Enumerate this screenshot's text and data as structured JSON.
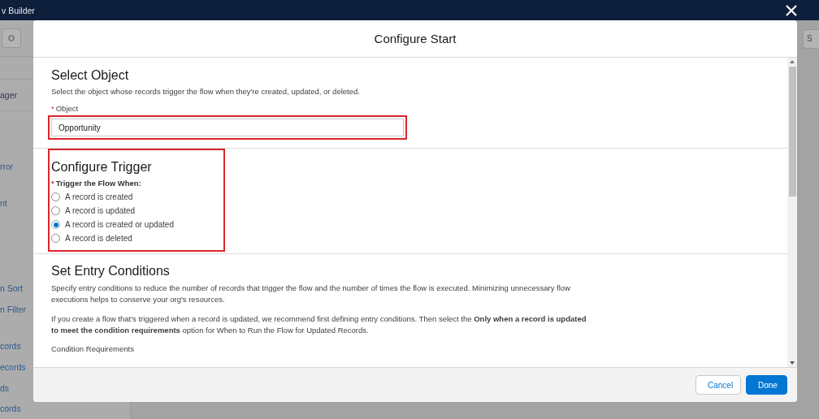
{
  "app_bar": {
    "title": "v Builder"
  },
  "toolbar": {
    "right_button": "S"
  },
  "sidebar": {
    "tab": "ager",
    "items": [
      "rror",
      "nt",
      "n Sort",
      "n Filter",
      "cords",
      "ecords",
      "ds",
      "cords"
    ]
  },
  "modal": {
    "title": "Configure Start",
    "select_object": {
      "heading": "Select Object",
      "description": "Select the object whose records trigger the flow when they're created, updated, or deleted.",
      "field": {
        "label": "Object",
        "required_mark": "*",
        "value": "Opportunity",
        "highlighted": true
      }
    },
    "configure_trigger": {
      "heading": "Configure Trigger",
      "highlighted": true,
      "label": "Trigger the Flow When:",
      "required_mark": "*",
      "options": [
        {
          "label": "A record is created",
          "selected": false
        },
        {
          "label": "A record is updated",
          "selected": false
        },
        {
          "label": "A record is created or updated",
          "selected": true
        },
        {
          "label": "A record is deleted",
          "selected": false
        }
      ]
    },
    "entry_conditions": {
      "heading": "Set Entry Conditions",
      "paragraphs": [
        "Specify entry conditions to reduce the number of records that trigger the flow and the number of times the flow is executed. Minimizing unnecessary flow executions helps to conserve your org's resources.",
        "If you create a flow that's triggered when a record is updated, we recommend first defining entry conditions. Then select the **Only when a record is updated to meet the condition requirements** option for When to Run the Flow for Updated Records."
      ],
      "subheading": "Condition Requirements"
    },
    "buttons": [
      {
        "label": "Cancel",
        "kind": "neutral"
      },
      {
        "label": "Done",
        "kind": "brand"
      }
    ]
  }
}
